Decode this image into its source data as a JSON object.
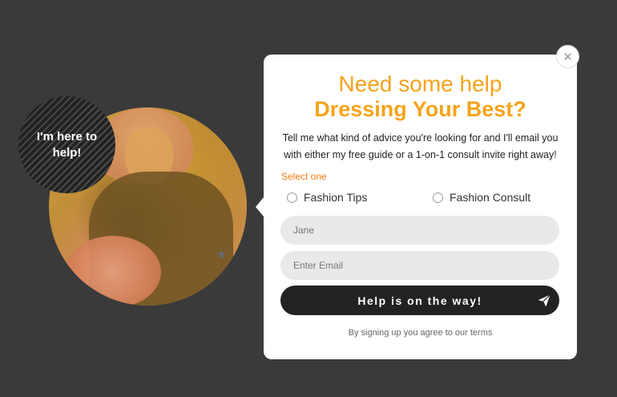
{
  "bubble": {
    "text": "I'm here to help!"
  },
  "card": {
    "heading_line1": "Need some help",
    "heading_line2": "Dressing Your Best?",
    "description": "Tell me what kind of advice you're looking for and I'll email you with either my free guide or a 1-on-1 consult invite right away!",
    "select_label": "Select one",
    "options": [
      "Fashion Tips",
      "Fashion Consult"
    ],
    "name_placeholder": "Jane",
    "email_placeholder": "Enter Email",
    "submit_label": "Help is on the way!",
    "terms": "By signing up you agree to our terms"
  },
  "colors": {
    "accent": "#f5a31a",
    "select_label": "#f07c10",
    "button": "#222222",
    "background": "#3a3a3a"
  },
  "icons": {
    "close": "close-icon",
    "send": "paper-plane-icon",
    "star": "star-icon"
  }
}
